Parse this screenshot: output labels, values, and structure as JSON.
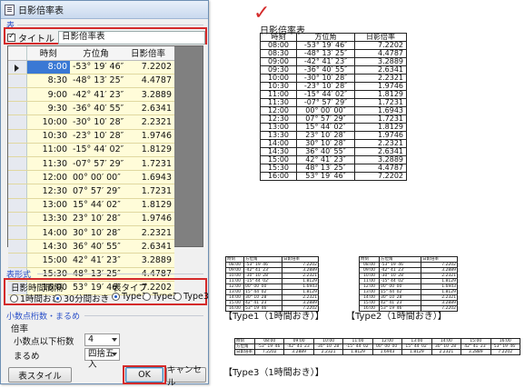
{
  "window": {
    "title": "日影倍率表"
  },
  "table_section": {
    "label": "表",
    "title_checkbox_label": "タイトル",
    "title_checked": true,
    "title_value": "日影倍率表",
    "headers": [
      "時刻",
      "方位角",
      "日影倍率"
    ],
    "rows": [
      [
        "8:00",
        "-53° 19′ 46″",
        "7.2202"
      ],
      [
        "8:30",
        "-48° 13′ 25″",
        "4.4787"
      ],
      [
        "9:00",
        "-42° 41′ 23″",
        "3.2889"
      ],
      [
        "9:30",
        "-36° 40′ 55″",
        "2.6341"
      ],
      [
        "10:00",
        "-30° 10′ 28″",
        "2.2321"
      ],
      [
        "10:30",
        "-23° 10′ 28″",
        "1.9746"
      ],
      [
        "11:00",
        "-15° 44′ 02″",
        "1.8129"
      ],
      [
        "11:30",
        "-07° 57′ 29″",
        "1.7231"
      ],
      [
        "12:00",
        "00° 00′ 00″",
        "1.6943"
      ],
      [
        "12:30",
        "07° 57′ 29″",
        "1.7231"
      ],
      [
        "13:00",
        "15° 44′ 02″",
        "1.8129"
      ],
      [
        "13:30",
        "23° 10′ 28″",
        "1.9746"
      ],
      [
        "14:00",
        "30° 10′ 28″",
        "2.2321"
      ],
      [
        "14:30",
        "36° 40′ 55″",
        "2.6341"
      ],
      [
        "15:00",
        "42° 41′ 23″",
        "3.2889"
      ],
      [
        "15:30",
        "48° 13′ 25″",
        "4.4787"
      ],
      [
        "16:00",
        "53° 19′ 46″",
        "7.2202"
      ]
    ]
  },
  "format_section": {
    "label": "表形式",
    "interval_group": {
      "title": "日影時間間隔",
      "options": [
        "1時間おき",
        "30分間おき"
      ],
      "selected": "30分間おき"
    },
    "type_group": {
      "title": "表タイプ",
      "options": [
        "Type1",
        "Type2",
        "Type3"
      ],
      "selected": "Type1"
    }
  },
  "decimal_section": {
    "label": "小数点桁数・まるめ",
    "group_title": "倍率",
    "digits_label": "小数点以下桁数",
    "digits_value": "4",
    "rounding_label": "まるめ",
    "rounding_value": "四捨五入"
  },
  "buttons": {
    "style": "表スタイル",
    "ok": "OK",
    "cancel": "キャンセル"
  },
  "preview": {
    "title": "日影倍率表",
    "headers": [
      "時刻",
      "方位角",
      "日影倍率"
    ],
    "rows": [
      [
        "08:00",
        "-53° 19′ 46″",
        "7.2202"
      ],
      [
        "08:30",
        "-48° 13′ 25″",
        "4.4787"
      ],
      [
        "09:00",
        "-42° 41′ 23″",
        "3.2889"
      ],
      [
        "09:30",
        "-36° 40′ 55″",
        "2.6341"
      ],
      [
        "10:00",
        "-30° 10′ 28″",
        "2.2321"
      ],
      [
        "10:30",
        "-23° 10′ 28″",
        "1.9746"
      ],
      [
        "11:00",
        "-15° 44′ 02″",
        "1.8129"
      ],
      [
        "11:30",
        "-07° 57′ 29″",
        "1.7231"
      ],
      [
        "12:00",
        "00° 00′ 00″",
        "1.6943"
      ],
      [
        "12:30",
        "07° 57′ 29″",
        "1.7231"
      ],
      [
        "13:00",
        "15° 44′ 02″",
        "1.8129"
      ],
      [
        "13:30",
        "23° 10′ 28″",
        "1.9746"
      ],
      [
        "14:00",
        "30° 10′ 28″",
        "2.2321"
      ],
      [
        "14:30",
        "36° 40′ 55″",
        "2.6341"
      ],
      [
        "15:00",
        "42° 41′ 23″",
        "3.2889"
      ],
      [
        "15:30",
        "48° 13′ 25″",
        "4.4787"
      ],
      [
        "16:00",
        "53° 19′ 46″",
        "7.2202"
      ]
    ],
    "captions": [
      "【Type1（1時間おき）】",
      "【Type2（1時間おき）】",
      "【Type3（1時間おき）】"
    ],
    "hourly_rows": [
      [
        "08:00",
        "-53° 19′ 46″",
        "7.2202"
      ],
      [
        "09:00",
        "-42° 41′ 23″",
        "3.2889"
      ],
      [
        "10:00",
        "-30° 10′ 28″",
        "2.2321"
      ],
      [
        "11:00",
        "-15° 44′ 02″",
        "1.8129"
      ],
      [
        "12:00",
        "00° 00′ 00″",
        "1.6943"
      ],
      [
        "13:00",
        "15° 44′ 02″",
        "1.8129"
      ],
      [
        "14:00",
        "30° 10′ 28″",
        "2.2321"
      ],
      [
        "15:00",
        "42° 41′ 23″",
        "3.2889"
      ],
      [
        "16:00",
        "53° 19′ 46″",
        "7.2202"
      ]
    ]
  },
  "colors": {
    "accent_red": "#d42a2a",
    "selection_blue": "#3a78d4",
    "cell_yellow": "#fffcd9",
    "section_blue": "#2b50c8"
  }
}
